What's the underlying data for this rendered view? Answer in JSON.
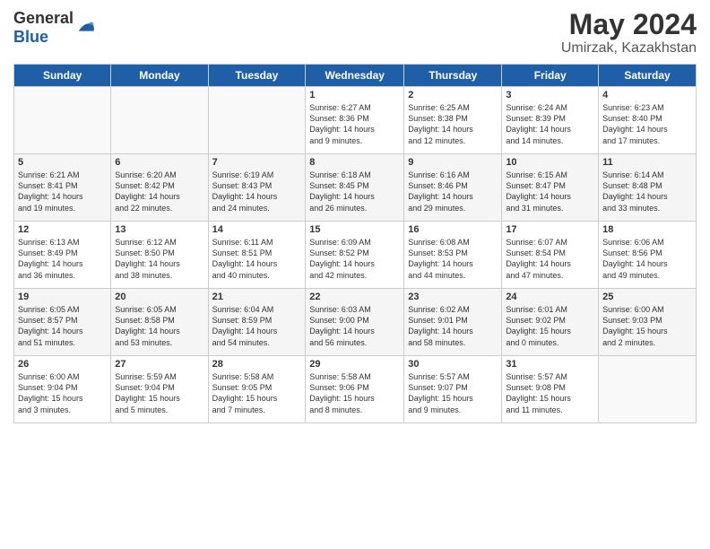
{
  "header": {
    "logo_general": "General",
    "logo_blue": "Blue",
    "title": "May 2024",
    "subtitle": "Umirzak, Kazakhstan"
  },
  "calendar": {
    "days": [
      "Sunday",
      "Monday",
      "Tuesday",
      "Wednesday",
      "Thursday",
      "Friday",
      "Saturday"
    ]
  },
  "weeks": [
    [
      {
        "day": "",
        "text": ""
      },
      {
        "day": "",
        "text": ""
      },
      {
        "day": "",
        "text": ""
      },
      {
        "day": "1",
        "text": "Sunrise: 6:27 AM\nSunset: 8:36 PM\nDaylight: 14 hours\nand 9 minutes."
      },
      {
        "day": "2",
        "text": "Sunrise: 6:25 AM\nSunset: 8:38 PM\nDaylight: 14 hours\nand 12 minutes."
      },
      {
        "day": "3",
        "text": "Sunrise: 6:24 AM\nSunset: 8:39 PM\nDaylight: 14 hours\nand 14 minutes."
      },
      {
        "day": "4",
        "text": "Sunrise: 6:23 AM\nSunset: 8:40 PM\nDaylight: 14 hours\nand 17 minutes."
      }
    ],
    [
      {
        "day": "5",
        "text": "Sunrise: 6:21 AM\nSunset: 8:41 PM\nDaylight: 14 hours\nand 19 minutes."
      },
      {
        "day": "6",
        "text": "Sunrise: 6:20 AM\nSunset: 8:42 PM\nDaylight: 14 hours\nand 22 minutes."
      },
      {
        "day": "7",
        "text": "Sunrise: 6:19 AM\nSunset: 8:43 PM\nDaylight: 14 hours\nand 24 minutes."
      },
      {
        "day": "8",
        "text": "Sunrise: 6:18 AM\nSunset: 8:45 PM\nDaylight: 14 hours\nand 26 minutes."
      },
      {
        "day": "9",
        "text": "Sunrise: 6:16 AM\nSunset: 8:46 PM\nDaylight: 14 hours\nand 29 minutes."
      },
      {
        "day": "10",
        "text": "Sunrise: 6:15 AM\nSunset: 8:47 PM\nDaylight: 14 hours\nand 31 minutes."
      },
      {
        "day": "11",
        "text": "Sunrise: 6:14 AM\nSunset: 8:48 PM\nDaylight: 14 hours\nand 33 minutes."
      }
    ],
    [
      {
        "day": "12",
        "text": "Sunrise: 6:13 AM\nSunset: 8:49 PM\nDaylight: 14 hours\nand 36 minutes."
      },
      {
        "day": "13",
        "text": "Sunrise: 6:12 AM\nSunset: 8:50 PM\nDaylight: 14 hours\nand 38 minutes."
      },
      {
        "day": "14",
        "text": "Sunrise: 6:11 AM\nSunset: 8:51 PM\nDaylight: 14 hours\nand 40 minutes."
      },
      {
        "day": "15",
        "text": "Sunrise: 6:09 AM\nSunset: 8:52 PM\nDaylight: 14 hours\nand 42 minutes."
      },
      {
        "day": "16",
        "text": "Sunrise: 6:08 AM\nSunset: 8:53 PM\nDaylight: 14 hours\nand 44 minutes."
      },
      {
        "day": "17",
        "text": "Sunrise: 6:07 AM\nSunset: 8:54 PM\nDaylight: 14 hours\nand 47 minutes."
      },
      {
        "day": "18",
        "text": "Sunrise: 6:06 AM\nSunset: 8:56 PM\nDaylight: 14 hours\nand 49 minutes."
      }
    ],
    [
      {
        "day": "19",
        "text": "Sunrise: 6:05 AM\nSunset: 8:57 PM\nDaylight: 14 hours\nand 51 minutes."
      },
      {
        "day": "20",
        "text": "Sunrise: 6:05 AM\nSunset: 8:58 PM\nDaylight: 14 hours\nand 53 minutes."
      },
      {
        "day": "21",
        "text": "Sunrise: 6:04 AM\nSunset: 8:59 PM\nDaylight: 14 hours\nand 54 minutes."
      },
      {
        "day": "22",
        "text": "Sunrise: 6:03 AM\nSunset: 9:00 PM\nDaylight: 14 hours\nand 56 minutes."
      },
      {
        "day": "23",
        "text": "Sunrise: 6:02 AM\nSunset: 9:01 PM\nDaylight: 14 hours\nand 58 minutes."
      },
      {
        "day": "24",
        "text": "Sunrise: 6:01 AM\nSunset: 9:02 PM\nDaylight: 15 hours\nand 0 minutes."
      },
      {
        "day": "25",
        "text": "Sunrise: 6:00 AM\nSunset: 9:03 PM\nDaylight: 15 hours\nand 2 minutes."
      }
    ],
    [
      {
        "day": "26",
        "text": "Sunrise: 6:00 AM\nSunset: 9:04 PM\nDaylight: 15 hours\nand 3 minutes."
      },
      {
        "day": "27",
        "text": "Sunrise: 5:59 AM\nSunset: 9:04 PM\nDaylight: 15 hours\nand 5 minutes."
      },
      {
        "day": "28",
        "text": "Sunrise: 5:58 AM\nSunset: 9:05 PM\nDaylight: 15 hours\nand 7 minutes."
      },
      {
        "day": "29",
        "text": "Sunrise: 5:58 AM\nSunset: 9:06 PM\nDaylight: 15 hours\nand 8 minutes."
      },
      {
        "day": "30",
        "text": "Sunrise: 5:57 AM\nSunset: 9:07 PM\nDaylight: 15 hours\nand 9 minutes."
      },
      {
        "day": "31",
        "text": "Sunrise: 5:57 AM\nSunset: 9:08 PM\nDaylight: 15 hours\nand 11 minutes."
      },
      {
        "day": "",
        "text": ""
      }
    ]
  ]
}
